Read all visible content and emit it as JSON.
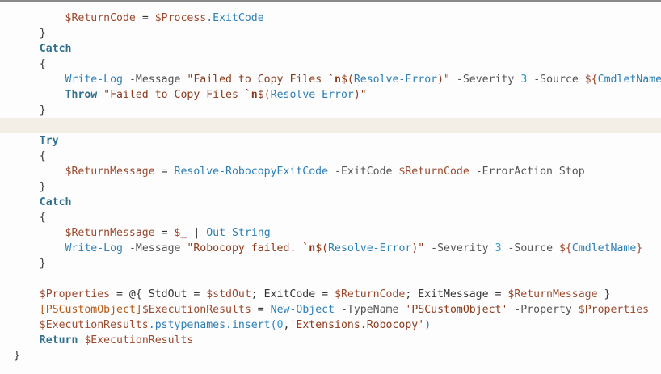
{
  "editor": {
    "highlighted_line": 7,
    "colors": {
      "keyword": "#2f6f8f",
      "variable": "#9b4a2e",
      "command": "#2e7fb5",
      "string": "#8b3a1b",
      "number": "#2a9ad0",
      "type": "#b85a14",
      "highlight_background": "#f4efe6"
    },
    "lines": [
      [
        {
          "t": "        ",
          "k": "txt"
        },
        {
          "t": "$ReturnCode",
          "k": "var"
        },
        {
          "t": " = ",
          "k": "op"
        },
        {
          "t": "$Process",
          "k": "var"
        },
        {
          "t": ".ExitCode",
          "k": "cmd"
        }
      ],
      [
        {
          "t": "    }",
          "k": "txt"
        }
      ],
      [
        {
          "t": "    ",
          "k": "txt"
        },
        {
          "t": "Catch",
          "k": "kw"
        }
      ],
      [
        {
          "t": "    {",
          "k": "txt"
        }
      ],
      [
        {
          "t": "        ",
          "k": "txt"
        },
        {
          "t": "Write-Log",
          "k": "cmd"
        },
        {
          "t": " -Message ",
          "k": "param"
        },
        {
          "t": "\"Failed to Copy Files ",
          "k": "str"
        },
        {
          "t": "`n",
          "k": "esc"
        },
        {
          "t": "$(",
          "k": "str"
        },
        {
          "t": "Resolve-Error",
          "k": "cmd"
        },
        {
          "t": ")\"",
          "k": "str"
        },
        {
          "t": " -Severity ",
          "k": "param"
        },
        {
          "t": "3",
          "k": "num"
        },
        {
          "t": " -Source ",
          "k": "param"
        },
        {
          "t": "${",
          "k": "var"
        },
        {
          "t": "CmdletName",
          "k": "cmd"
        },
        {
          "t": "}",
          "k": "var"
        }
      ],
      [
        {
          "t": "        ",
          "k": "txt"
        },
        {
          "t": "Throw",
          "k": "kw"
        },
        {
          "t": " \"Failed to Copy Files ",
          "k": "str"
        },
        {
          "t": "`n",
          "k": "esc"
        },
        {
          "t": "$(",
          "k": "str"
        },
        {
          "t": "Resolve-Error",
          "k": "cmd"
        },
        {
          "t": ")\"",
          "k": "str"
        }
      ],
      [
        {
          "t": "    }",
          "k": "txt"
        }
      ],
      [],
      [
        {
          "t": "    ",
          "k": "txt"
        },
        {
          "t": "Try",
          "k": "kw"
        }
      ],
      [
        {
          "t": "    {",
          "k": "txt"
        }
      ],
      [
        {
          "t": "        ",
          "k": "txt"
        },
        {
          "t": "$ReturnMessage",
          "k": "var"
        },
        {
          "t": " = ",
          "k": "op"
        },
        {
          "t": "Resolve-RobocopyExitCode",
          "k": "cmd"
        },
        {
          "t": " -ExitCode ",
          "k": "param"
        },
        {
          "t": "$ReturnCode",
          "k": "var"
        },
        {
          "t": " -ErrorAction Stop",
          "k": "param"
        }
      ],
      [
        {
          "t": "    }",
          "k": "txt"
        }
      ],
      [
        {
          "t": "    ",
          "k": "txt"
        },
        {
          "t": "Catch",
          "k": "kw"
        }
      ],
      [
        {
          "t": "    {",
          "k": "txt"
        }
      ],
      [
        {
          "t": "        ",
          "k": "txt"
        },
        {
          "t": "$ReturnMessage",
          "k": "var"
        },
        {
          "t": " = ",
          "k": "op"
        },
        {
          "t": "$_",
          "k": "var"
        },
        {
          "t": " | ",
          "k": "op"
        },
        {
          "t": "Out-String",
          "k": "cmd"
        }
      ],
      [
        {
          "t": "        ",
          "k": "txt"
        },
        {
          "t": "Write-Log",
          "k": "cmd"
        },
        {
          "t": " -Message ",
          "k": "param"
        },
        {
          "t": "\"Robocopy failed. ",
          "k": "str"
        },
        {
          "t": "`n",
          "k": "esc"
        },
        {
          "t": "$(",
          "k": "str"
        },
        {
          "t": "Resolve-Error",
          "k": "cmd"
        },
        {
          "t": ")\"",
          "k": "str"
        },
        {
          "t": " -Severity ",
          "k": "param"
        },
        {
          "t": "3",
          "k": "num"
        },
        {
          "t": " -Source ",
          "k": "param"
        },
        {
          "t": "${",
          "k": "var"
        },
        {
          "t": "CmdletName",
          "k": "cmd"
        },
        {
          "t": "}",
          "k": "var"
        }
      ],
      [
        {
          "t": "    }",
          "k": "txt"
        }
      ],
      [],
      [
        {
          "t": "    ",
          "k": "txt"
        },
        {
          "t": "$Properties",
          "k": "var"
        },
        {
          "t": " = @{ StdOut = ",
          "k": "op"
        },
        {
          "t": "$stdOut",
          "k": "var"
        },
        {
          "t": "; ExitCode = ",
          "k": "op"
        },
        {
          "t": "$ReturnCode",
          "k": "var"
        },
        {
          "t": "; ExitMessage = ",
          "k": "op"
        },
        {
          "t": "$ReturnMessage",
          "k": "var"
        },
        {
          "t": " }",
          "k": "op"
        }
      ],
      [
        {
          "t": "    ",
          "k": "txt"
        },
        {
          "t": "[PSCustomObject]",
          "k": "type"
        },
        {
          "t": "$ExecutionResults",
          "k": "var"
        },
        {
          "t": " = ",
          "k": "op"
        },
        {
          "t": "New-Object",
          "k": "cmd"
        },
        {
          "t": " -TypeName ",
          "k": "param"
        },
        {
          "t": "'PSCustomObject'",
          "k": "str"
        },
        {
          "t": " -Property ",
          "k": "param"
        },
        {
          "t": "$Properties",
          "k": "var"
        }
      ],
      [
        {
          "t": "    ",
          "k": "txt"
        },
        {
          "t": "$ExecutionResults",
          "k": "var"
        },
        {
          "t": ".pstypenames.insert(",
          "k": "cmd"
        },
        {
          "t": "0",
          "k": "num"
        },
        {
          "t": ",",
          "k": "op"
        },
        {
          "t": "'Extensions.Robocopy'",
          "k": "str"
        },
        {
          "t": ")",
          "k": "cmd"
        }
      ],
      [
        {
          "t": "    ",
          "k": "txt"
        },
        {
          "t": "Return",
          "k": "kw"
        },
        {
          "t": " ",
          "k": "txt"
        },
        {
          "t": "$ExecutionResults",
          "k": "var"
        }
      ],
      [
        {
          "t": "}",
          "k": "txt"
        }
      ]
    ]
  }
}
